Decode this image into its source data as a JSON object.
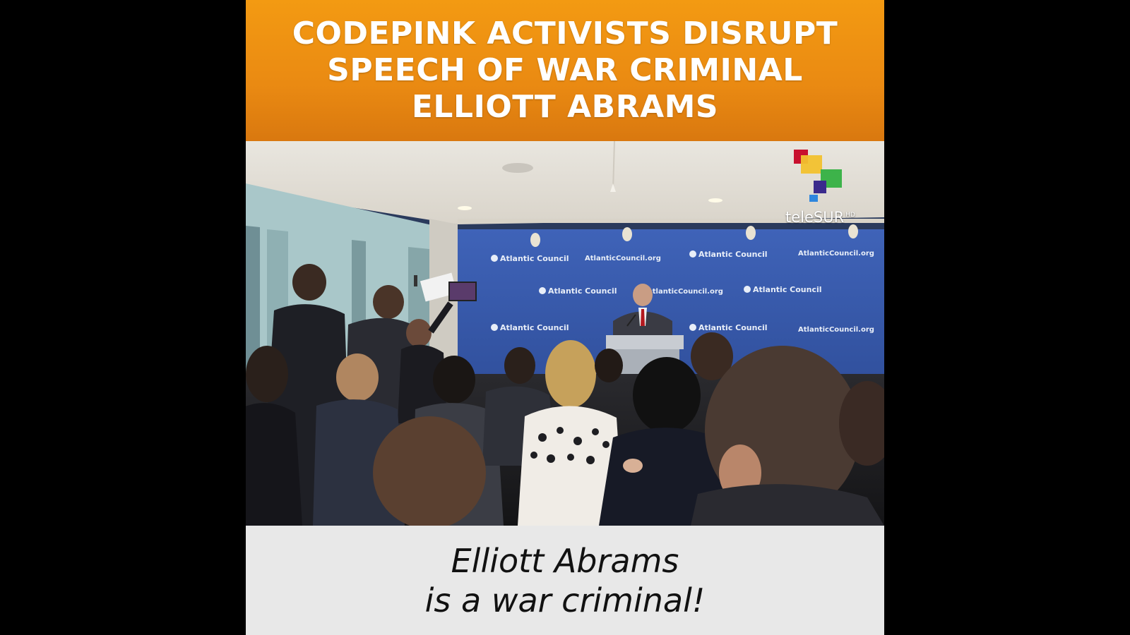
{
  "headline": {
    "line1": "CODEPINK ACTIVISTS DISRUPT",
    "line2": "SPEECH OF WAR CRIMINAL",
    "line3": "ELLIOTT ABRAMS"
  },
  "logo": {
    "name": "teleSUR",
    "badge": "HD",
    "icon": "telesur-squares-icon",
    "colors": [
      "#c8102e",
      "#f2c12e",
      "#3db34a",
      "#3a2a8c",
      "#2e86de"
    ]
  },
  "backdrop": {
    "brand_label": "Atlantic Council",
    "url_label": "AtlanticCouncil.org",
    "color": "#3a5bb0"
  },
  "caption": {
    "line1": "Elliott Abrams",
    "line2": "is a war criminal!"
  }
}
